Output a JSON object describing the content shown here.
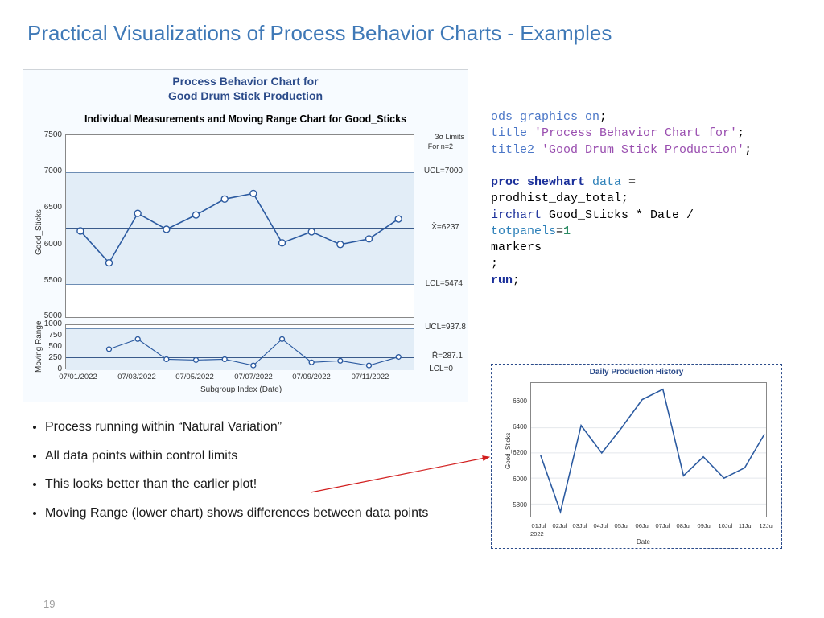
{
  "slide": {
    "title": "Practical Visualizations of Process Behavior Charts - Examples",
    "number": "19"
  },
  "main_chart": {
    "title1": "Process Behavior Chart for",
    "title2": "Good Drum Stick Production",
    "subhead": "Individual Measurements and Moving Range Chart for Good_Sticks",
    "y_label": "Good_Sticks",
    "mr_label": "Moving Range",
    "x_label": "Subgroup Index (Date)",
    "sigma_note1": "3σ Limits",
    "sigma_note2": "For n=2",
    "ucl_label": "UCL=7000",
    "center_label": "X̄=6237",
    "lcl_label": "LCL=5474",
    "mr_ucl_label": "UCL=937.8",
    "mr_center_label": "R̄=287.1",
    "mr_lcl_label": "LCL=0",
    "y_ticks": [
      "5000",
      "5500",
      "6000",
      "6500",
      "7000",
      "7500"
    ],
    "mr_ticks": [
      "0",
      "250",
      "500",
      "750",
      "1000"
    ],
    "x_ticks": [
      "07/01/2022",
      "07/03/2022",
      "07/05/2022",
      "07/07/2022",
      "07/09/2022",
      "07/11/2022"
    ]
  },
  "code": {
    "l1a": "ods graphics on",
    "l1b": ";",
    "l2a": "title",
    "l2b": " 'Process Behavior Chart for'",
    "l2c": ";",
    "l3a": "title2",
    "l3b": " 'Good Drum Stick Production'",
    "l3c": ";",
    "l4a": "proc shewhart",
    "l4b": " data",
    "l4c": " =",
    "l5": "prodhist_day_total;",
    "l6a": "irchart",
    "l6b": " Good_Sticks * Date /",
    "l7a": "totpanels",
    "l7b": "=",
    "l7c": "1",
    "l8": "markers",
    "l9": ";",
    "l10a": "run",
    "l10b": ";"
  },
  "mini_chart": {
    "title": "Daily Production History",
    "y_label": "Good_Sticks",
    "x_label": "Date",
    "y_ticks": [
      "5800",
      "6000",
      "6200",
      "6400",
      "6600"
    ],
    "x_ticks": [
      "01Jul",
      "02Jul",
      "03Jul",
      "04Jul",
      "05Jul",
      "06Jul",
      "07Jul",
      "08Jul",
      "09Jul",
      "10Jul",
      "11Jul",
      "12Jul"
    ],
    "year": "2022"
  },
  "bullets": {
    "b1": "Process running within “Natural Variation”",
    "b2": "All data points within control limits",
    "b3": "This looks better than the earlier plot!",
    "b4": "Moving Range (lower chart) shows differences between data points"
  },
  "chart_data": [
    {
      "type": "line",
      "title": "Individual Measurements and Moving Range Chart for Good_Sticks",
      "subtitle_top": "Process Behavior Chart for Good Drum Stick Production",
      "panel": "individuals",
      "xlabel": "Subgroup Index (Date)",
      "ylabel": "Good_Sticks",
      "ylim": [
        5000,
        7500
      ],
      "ucl": 7000,
      "center": 6237,
      "lcl": 5474,
      "sigma": "3σ, n=2",
      "categories": [
        "07/01/2022",
        "07/02/2022",
        "07/03/2022",
        "07/04/2022",
        "07/05/2022",
        "07/06/2022",
        "07/07/2022",
        "07/08/2022",
        "07/09/2022",
        "07/10/2022",
        "07/11/2022",
        "07/12/2022"
      ],
      "values": [
        6180,
        5740,
        6420,
        6200,
        6400,
        6620,
        6700,
        6020,
        6170,
        6000,
        6080,
        6350
      ]
    },
    {
      "type": "line",
      "panel": "moving_range",
      "ylabel": "Moving Range",
      "ylim": [
        0,
        1000
      ],
      "ucl": 937.8,
      "center": 287.1,
      "lcl": 0,
      "categories": [
        "07/02/2022",
        "07/03/2022",
        "07/04/2022",
        "07/05/2022",
        "07/06/2022",
        "07/07/2022",
        "07/08/2022",
        "07/09/2022",
        "07/10/2022",
        "07/11/2022",
        "07/12/2022"
      ],
      "values": [
        440,
        680,
        220,
        200,
        220,
        80,
        680,
        150,
        170,
        80,
        270
      ]
    },
    {
      "type": "line",
      "title": "Daily Production History",
      "xlabel": "Date",
      "ylabel": "Good_Sticks",
      "ylim": [
        5700,
        6750
      ],
      "categories": [
        "01Jul",
        "02Jul",
        "03Jul",
        "04Jul",
        "05Jul",
        "06Jul",
        "07Jul",
        "08Jul",
        "09Jul",
        "10Jul",
        "11Jul",
        "12Jul"
      ],
      "year": "2022",
      "values": [
        6180,
        5740,
        6420,
        6200,
        6400,
        6620,
        6700,
        6020,
        6170,
        6000,
        6080,
        6350
      ]
    }
  ]
}
